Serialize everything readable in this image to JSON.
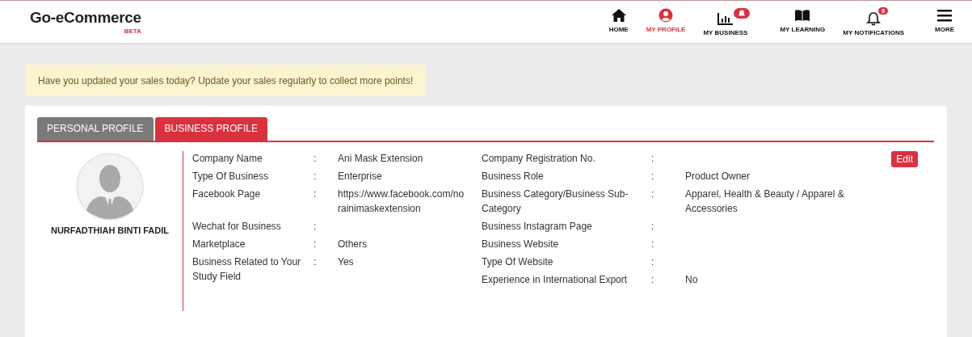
{
  "brand": {
    "name": "Go-eCommerce",
    "tag": "BETA"
  },
  "nav": [
    {
      "kind": "home",
      "label": "HOME",
      "selected": false
    },
    {
      "kind": "profile",
      "label": "MY PROFILE",
      "selected": true
    },
    {
      "kind": "business",
      "label": "MY BUSINESS",
      "selected": false,
      "badge": {
        "kind": "alert"
      }
    },
    {
      "kind": "learning",
      "label": "MY LEARNING",
      "selected": false
    },
    {
      "kind": "notifications",
      "label": "MY NOTIFICATIONS",
      "selected": false,
      "badge": {
        "kind": "count",
        "text": "8"
      }
    },
    {
      "kind": "more",
      "label": "MORE",
      "selected": false
    }
  ],
  "notice": "Have you updated your sales today? Update your sales regularly to collect more points!",
  "tabs": [
    {
      "label": "PERSONAL PROFILE",
      "selected": false
    },
    {
      "label": "BUSINESS PROFILE",
      "selected": true
    }
  ],
  "profile": {
    "name": "NURFADTHIAH BINTI FADIL"
  },
  "edit_button": "Edit",
  "fields_left": [
    {
      "label": "Company Name",
      "separator": ":",
      "value": "Ani Mask Extension"
    },
    {
      "label": "Type Of Business",
      "separator": ":",
      "value": "Enterprise"
    },
    {
      "label": "Facebook Page",
      "separator": ":",
      "value": "https://www.facebook.com/norainimaskextension"
    },
    {
      "label": "Wechat for Business",
      "separator": ":"
    },
    {
      "label": "Marketplace",
      "separator": ":",
      "value": "Others"
    },
    {
      "label": "Business Related to Your Study Field",
      "separator": ":",
      "value": "Yes"
    }
  ],
  "fields_right": [
    {
      "label": "Company Registration No.",
      "separator": ":"
    },
    {
      "label": "Business Role",
      "separator": ":",
      "value": "Product Owner"
    },
    {
      "label": "Business Category/Business Sub-Category",
      "separator": ":",
      "value": "Apparel, Health & Beauty / Apparel & Accessories"
    },
    {
      "label": "Business Instagram Page",
      "separator": ":"
    },
    {
      "label": "Business Website",
      "separator": ":"
    },
    {
      "label": "Type Of Website",
      "separator": ":"
    },
    {
      "label": "Experience in International Export",
      "separator": ":",
      "value": "No"
    }
  ]
}
